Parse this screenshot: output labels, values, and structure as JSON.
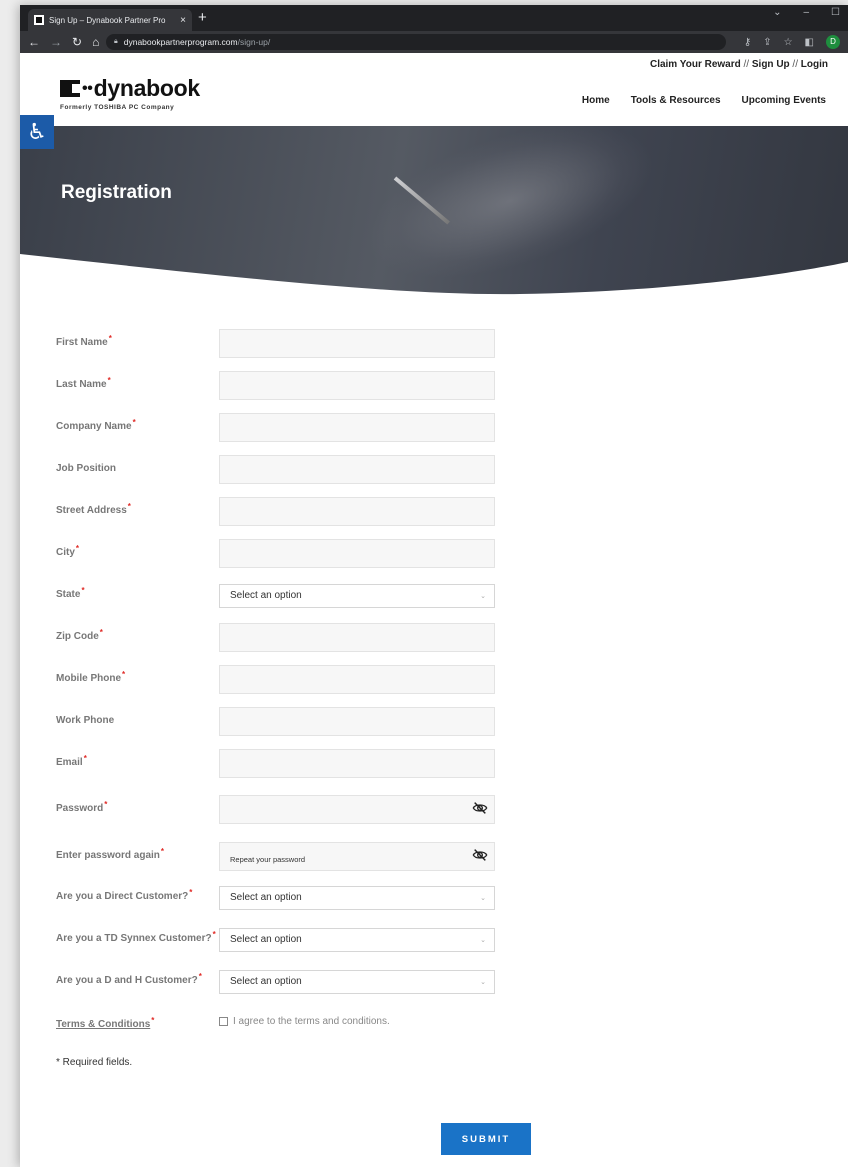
{
  "browser": {
    "tab_title": "Sign Up – Dynabook Partner Pro",
    "tab_close": "×",
    "new_tab": "+",
    "url_domain": "dynabookpartnerprogram.com",
    "url_path": "/sign-up/",
    "profile_initial": "D"
  },
  "header": {
    "topline": {
      "claim": "Claim Your Reward",
      "sep": " // ",
      "signup": "Sign Up",
      "login": "Login"
    },
    "logo_text": "dynabook",
    "logo_sub": "Formerly TOSHIBA PC Company",
    "nav": [
      "Home",
      "Tools & Resources",
      "Upcoming Events"
    ]
  },
  "hero": {
    "title": "Registration"
  },
  "form": {
    "fields": [
      {
        "label": "First Name",
        "required": "*"
      },
      {
        "label": "Last Name",
        "required": "*"
      },
      {
        "label": "Company Name",
        "required": "*"
      },
      {
        "label": "Job Position",
        "required": ""
      },
      {
        "label": "Street Address",
        "required": "*"
      },
      {
        "label": "City",
        "required": "*"
      },
      {
        "label": "State",
        "required": "*",
        "value": "Select an option"
      },
      {
        "label": "Zip Code",
        "required": "*"
      },
      {
        "label": "Mobile Phone",
        "required": "*"
      },
      {
        "label": "Work Phone",
        "required": ""
      },
      {
        "label": "Email",
        "required": "*"
      },
      {
        "label": "Password",
        "required": "*"
      },
      {
        "label": "Enter password again",
        "required": "*",
        "placeholder": "Repeat your password"
      },
      {
        "label": "Are you a Direct Customer?",
        "required": "*",
        "value": "Select an option"
      },
      {
        "label": "Are you a TD Synnex Customer?",
        "required": "*",
        "value": "Select an option"
      },
      {
        "label": "Are you a D and H Customer?",
        "required": "*",
        "value": "Select an option"
      }
    ],
    "terms_label": "Terms & Conditions",
    "terms_required": "*",
    "terms_checkbox": "I agree to the terms and conditions.",
    "required_note": "* Required fields.",
    "submit_label": "SUBMIT"
  },
  "colors": {
    "accent": "#1a73c7",
    "required": "#e02b27",
    "accessibility": "#1c5ba8"
  }
}
